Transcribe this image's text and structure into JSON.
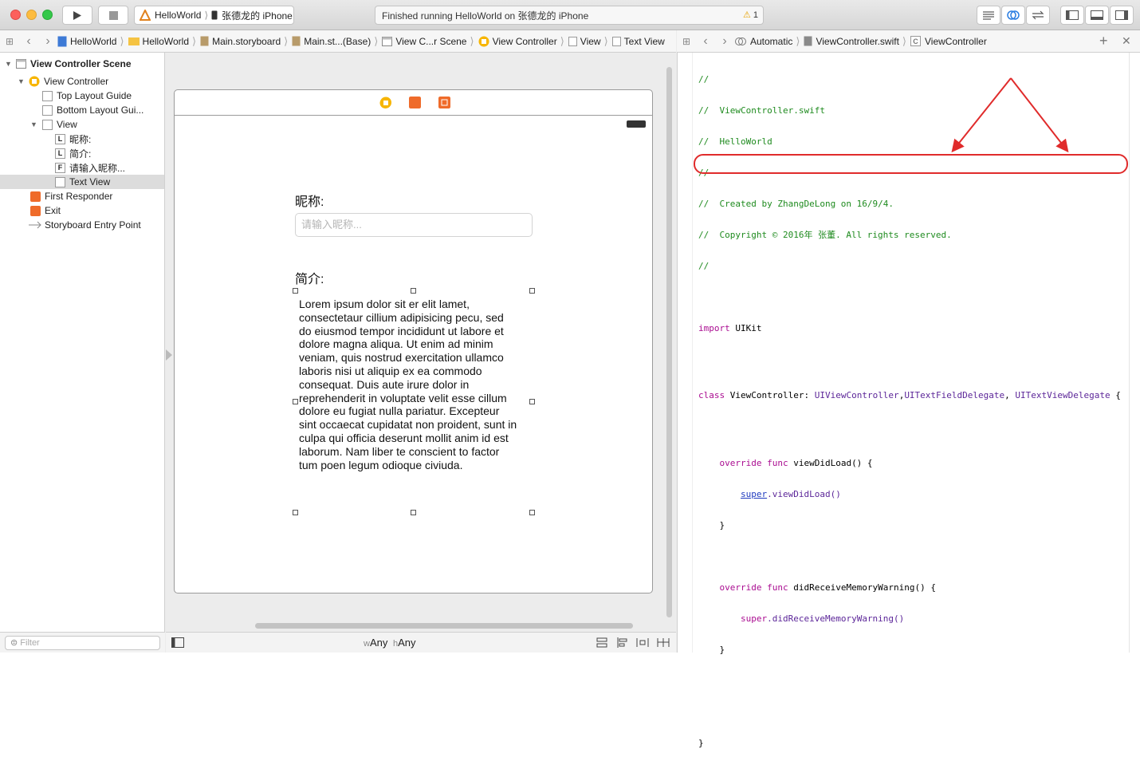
{
  "toolbar": {
    "scheme_app": "HelloWorld",
    "scheme_device": "张德龙的 iPhone",
    "status_text": "Finished running HelloWorld on 张德龙的 iPhone",
    "warning_count": "1"
  },
  "left_jumpbar": {
    "items": [
      "HelloWorld",
      "HelloWorld",
      "Main.storyboard",
      "Main.st...(Base)",
      "View C...r Scene",
      "View Controller",
      "View",
      "Text View"
    ]
  },
  "right_jumpbar": {
    "items": [
      "Automatic",
      "ViewController.swift",
      "ViewController"
    ]
  },
  "outline": {
    "scene_title": "View Controller Scene",
    "view_controller": "View Controller",
    "top_layout_guide": "Top Layout Guide",
    "bottom_layout_guide": "Bottom Layout Gui...",
    "view": "View",
    "label_nickname": "昵称:",
    "label_intro": "简介:",
    "field_nickname": "请输入昵称...",
    "text_view": "Text View",
    "first_responder": "First Responder",
    "exit": "Exit",
    "entry_point": "Storyboard Entry Point",
    "filter_placeholder": "Filter"
  },
  "canvas": {
    "nickname_label": "昵称:",
    "nickname_placeholder": "请输入昵称...",
    "intro_label": "简介:",
    "textview_lines": [
      "Lorem ipsum dolor sit er elit lamet,",
      "consectetaur cillium adipisicing pecu, sed",
      "do eiusmod tempor incididunt ut labore et",
      "dolore magna aliqua. Ut enim ad minim",
      "veniam, quis nostrud exercitation ullamco",
      "laboris nisi ut aliquip ex ea commodo",
      "consequat. Duis aute irure dolor in",
      "reprehenderit in voluptate velit esse cillum",
      "dolore eu fugiat nulla pariatur. Excepteur",
      "sint occaecat cupidatat non proident, sunt in",
      "culpa qui officia deserunt mollit anim id est",
      "laborum. Nam liber te conscient to factor",
      "tum poen legum odioque civiuda."
    ],
    "size_class_w_prefix": "w",
    "size_class_w": "Any",
    "size_class_h_prefix": "h",
    "size_class_h": "Any"
  },
  "code": {
    "c1": "//",
    "c2": "//  ViewController.swift",
    "c3": "//  HelloWorld",
    "c4": "//",
    "c5": "//  Created by ZhangDeLong on 16/9/4.",
    "c6": "//  Copyright © 2016年 张董. All rights reserved.",
    "c7": "//",
    "import_kw": "import",
    "import_mod": " UIKit",
    "class_kw": "class",
    "class_name": " ViewController: ",
    "super_type": "UIViewController",
    "comma1": ",",
    "proto1": "UITextFieldDelegate",
    "comma2": ", ",
    "proto2": "UITextViewDelegate",
    "open_brace": " {",
    "override1": "    override func",
    "fn1": " viewDidLoad() {",
    "super1": "super",
    "call1": ".viewDidLoad()",
    "close1": "    }",
    "override2": "    override func",
    "fn2": " didReceiveMemoryWarning() {",
    "super2": "super",
    "call2": ".didReceiveMemoryWarning()",
    "close2": "    }",
    "close_class": "}"
  }
}
